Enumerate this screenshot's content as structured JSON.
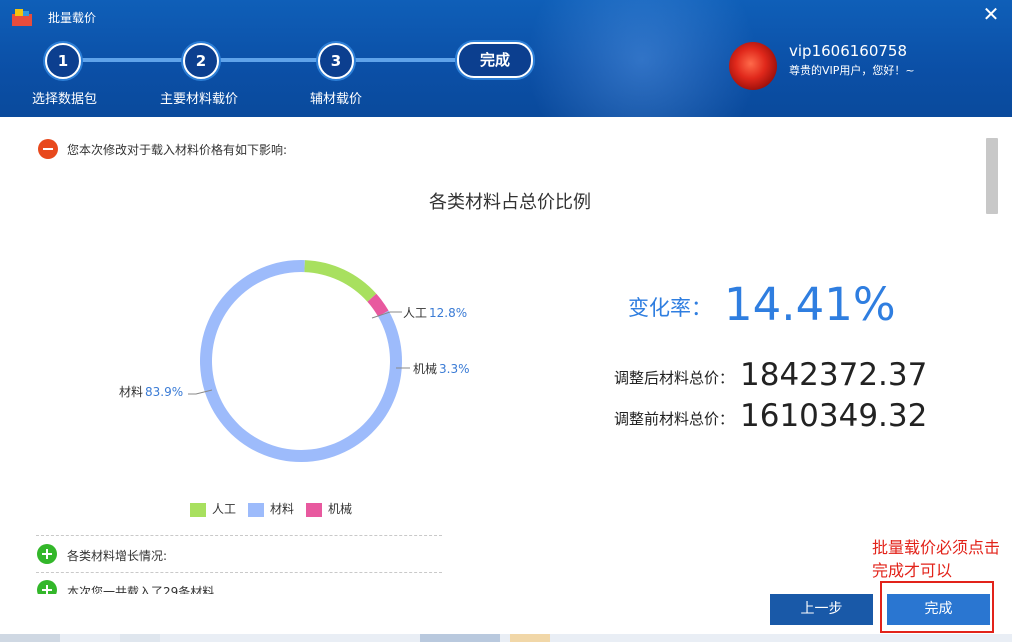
{
  "window": {
    "title": "批量载价"
  },
  "steps": [
    {
      "num": "1",
      "label": "选择数据包"
    },
    {
      "num": "2",
      "label": "主要材料载价"
    },
    {
      "num": "3",
      "label": "辅材载价"
    }
  ],
  "final_step": "完成",
  "user": {
    "name": "vip1606160758",
    "greeting": "尊贵的VIP用户，您好！~"
  },
  "notice": "您本次修改对于载入材料价格有如下影响:",
  "chart_data": {
    "type": "pie",
    "variant": "donut",
    "title": "各类材料占总价比例",
    "slices": [
      {
        "name": "人工",
        "value": 12.8,
        "label": "12.8%",
        "color": "#a8e05f"
      },
      {
        "name": "机械",
        "value": 3.3,
        "label": "3.3%",
        "color": "#e8599f"
      },
      {
        "name": "材料",
        "value": 83.9,
        "label": "83.9%",
        "color": "#9dbbfb"
      }
    ],
    "legend": [
      "人工",
      "材料",
      "机械"
    ],
    "legend_position": "bottom"
  },
  "stats": {
    "rate_label": "变化率：",
    "rate_value": "14.41%",
    "after_label": "调整后材料总价：",
    "after_value": "1842372.37",
    "before_label": "调整前材料总价：",
    "before_value": "1610349.32"
  },
  "sections": {
    "growth": "各类材料增长情况:",
    "loaded": "本次您一共载入了29条材料"
  },
  "annotation": "批量载价必须点击完成才可以",
  "buttons": {
    "prev": "上一步",
    "done": "完成"
  },
  "colors": {
    "header": "#0b4fa6",
    "accent": "#2f7ee0",
    "annotation": "#e2231a"
  }
}
